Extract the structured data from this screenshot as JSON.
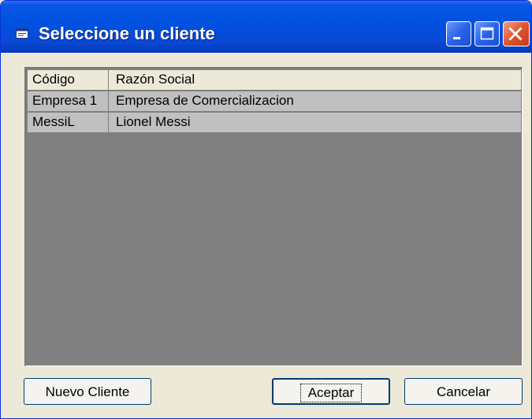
{
  "window": {
    "title": "Seleccione un cliente",
    "icon": "window-app-icon"
  },
  "title_buttons": {
    "minimize": "minimize-icon",
    "maximize": "maximize-icon",
    "close": "close-icon"
  },
  "grid": {
    "columns": [
      "Código",
      "Razón Social"
    ],
    "rows": [
      [
        "Empresa 1",
        "Empresa de Comercializacion"
      ],
      [
        "MessiL",
        "Lionel Messi"
      ]
    ]
  },
  "buttons": {
    "nuevo_cliente": "Nuevo Cliente",
    "aceptar": "Aceptar",
    "cancelar": "Cancelar"
  }
}
